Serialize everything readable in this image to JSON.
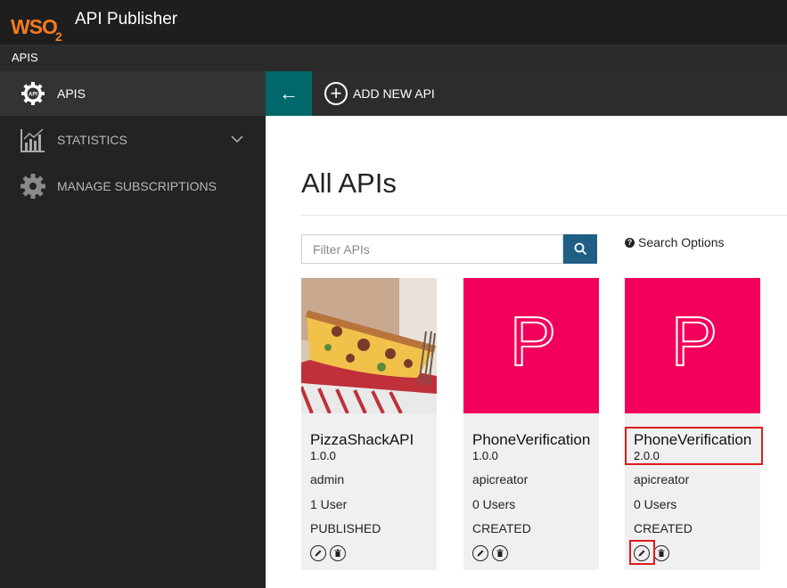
{
  "header": {
    "logo_text": "WSO",
    "logo_sub": "2",
    "app_title": "API Publisher"
  },
  "subbar": {
    "label": "APIS"
  },
  "sidebar": {
    "items": [
      {
        "label": "APIS",
        "icon": "api-gear-icon",
        "active": true
      },
      {
        "label": "STATISTICS",
        "icon": "chart-icon",
        "expandable": true
      },
      {
        "label": "MANAGE SUBSCRIPTIONS",
        "icon": "gear-icon"
      }
    ]
  },
  "toolbar": {
    "back_icon": "←",
    "add_label": "ADD NEW API",
    "add_icon": "+"
  },
  "main": {
    "title": "All APIs",
    "filter": {
      "placeholder": "Filter APIs",
      "value": ""
    },
    "search_options_label": "Search Options",
    "cards": [
      {
        "name": "PizzaShackAPI",
        "version": "1.0.0",
        "owner": "admin",
        "users": "1 User",
        "status": "PUBLISHED",
        "thumb": "pizza-photo"
      },
      {
        "name": "PhoneVerification",
        "version": "1.0.0",
        "owner": "apicreator",
        "users": "0 Users",
        "status": "CREATED",
        "thumb": "letter",
        "thumb_letter": "P"
      },
      {
        "name": "PhoneVerification",
        "version": "2.0.0",
        "owner": "apicreator",
        "users": "0 Users",
        "status": "CREATED",
        "thumb": "letter",
        "thumb_letter": "P"
      }
    ]
  },
  "colors": {
    "accent": "#00686b",
    "thumb_pink": "#f2005b",
    "search_btn": "#1f5f86",
    "highlight": "#e01b1b",
    "logo": "#f47b20"
  }
}
